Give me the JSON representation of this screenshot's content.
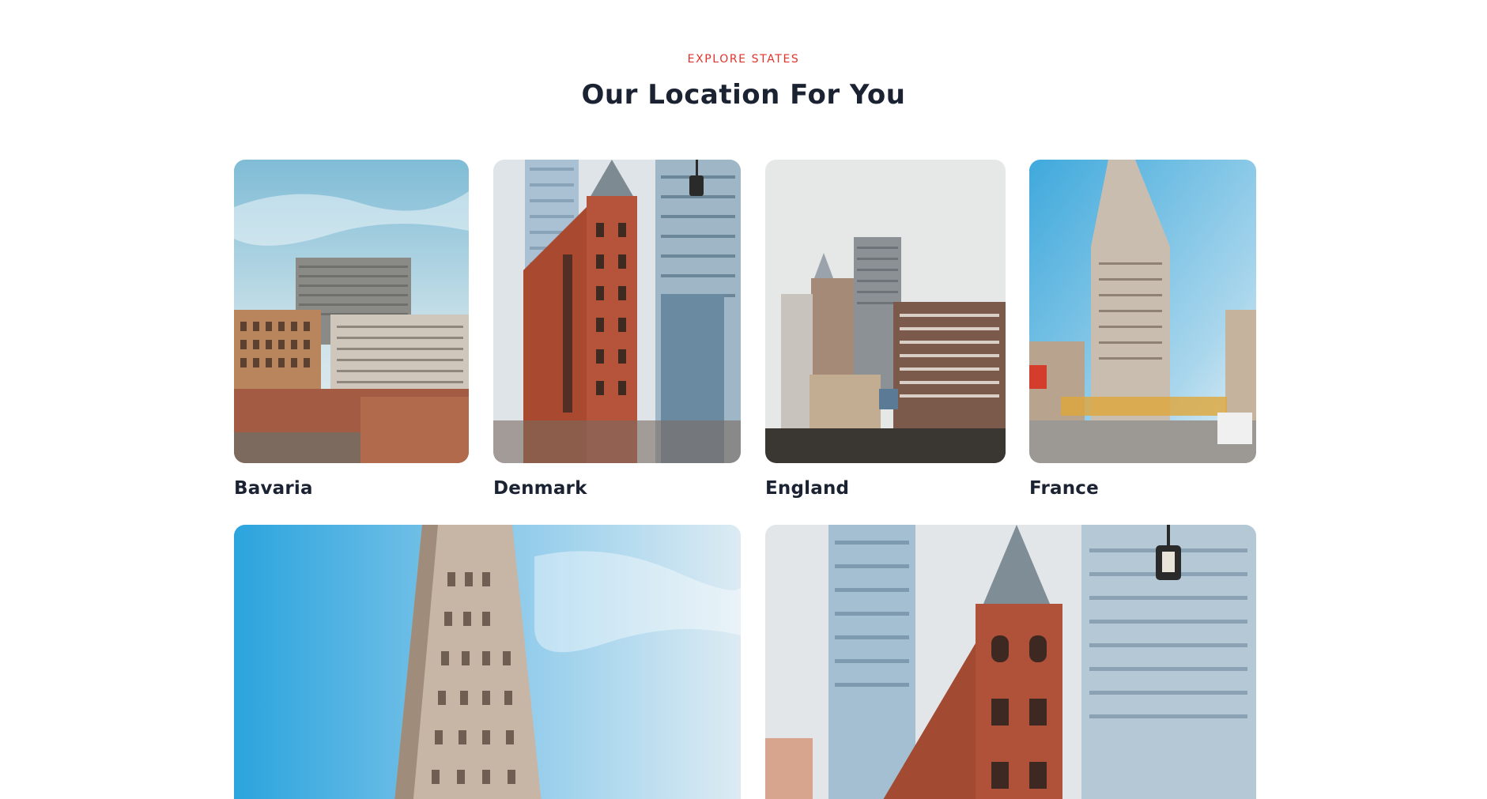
{
  "section": {
    "eyebrow": "EXPLORE STATES",
    "title": "Our Location For You"
  },
  "locations": [
    {
      "name": "Bavaria",
      "image": "city-buildings-photo"
    },
    {
      "name": "Denmark",
      "image": "red-brick-tower-photo"
    },
    {
      "name": "England",
      "image": "skyline-photo"
    },
    {
      "name": "France",
      "image": "flatiron-building-photo"
    },
    {
      "name": "",
      "image": "flatiron-closeup-photo"
    },
    {
      "name": "",
      "image": "red-brick-tower-closeup-photo"
    }
  ],
  "colors": {
    "accent": "#e0332a",
    "heading": "#1b2333",
    "sky": "#4fb4e4",
    "brick": "#b5543a"
  }
}
